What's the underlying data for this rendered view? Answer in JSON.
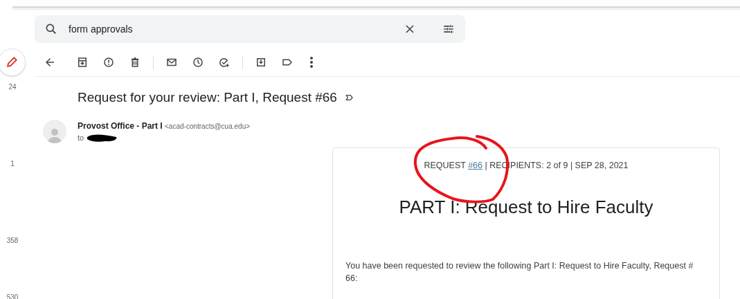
{
  "search": {
    "value": "form approvals"
  },
  "rail": {
    "counts": [
      "24",
      "1",
      "358",
      "530"
    ]
  },
  "message": {
    "subject": "Request for your review: Part I, Request #66",
    "sender_name": "Provost Office - Part I",
    "sender_email": "<acad-contracts@cua.edu>",
    "to_label": "to",
    "body": {
      "meta_start": "REQUEST ",
      "meta_link": "#66",
      "meta_end": " | RECIPIENTS: 2 of 9 | SEP 28, 2021",
      "title": "PART I: Request to Hire Faculty",
      "paragraph": "You have been requested to review the following Part I: Request to Hire Faculty, Request # 66:"
    }
  }
}
